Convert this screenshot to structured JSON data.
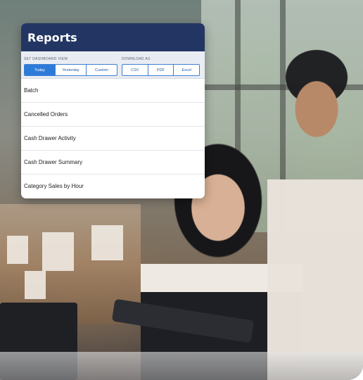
{
  "card": {
    "title": "Reports",
    "dashboard_view": {
      "label": "SET DASHBOARD VIEW",
      "options": [
        "Today",
        "Yesterday",
        "Custom"
      ],
      "selected": "Today"
    },
    "download": {
      "label": "DOWNLOAD AS",
      "options": [
        "CSV",
        "PDF",
        "Excel"
      ]
    },
    "reports": [
      "Batch",
      "Cancelled Orders",
      "Cash Drawer Activity",
      "Cash Drawer Summary",
      "Category Sales by Hour"
    ]
  },
  "colors": {
    "header": "#233663",
    "accent": "#2d7ad8"
  }
}
